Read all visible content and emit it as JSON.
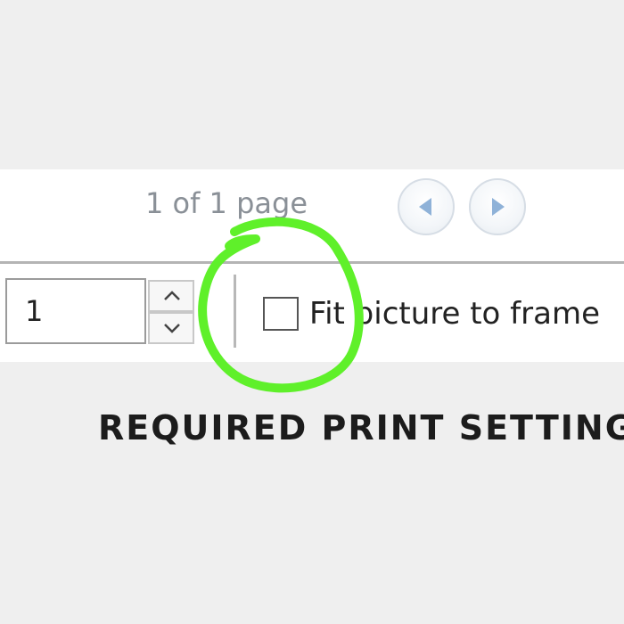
{
  "pagination": {
    "text": "1 of 1 page",
    "prev_icon": "triangle-left-icon",
    "next_icon": "triangle-right-icon"
  },
  "copies": {
    "value": "1",
    "up_icon": "chevron-up-icon",
    "down_icon": "chevron-down-icon"
  },
  "fit_option": {
    "label": "Fit picture to frame",
    "checked": false
  },
  "annotation": {
    "color": "#5ff02a",
    "caption": "REQUIRED PRINT SETTING"
  }
}
